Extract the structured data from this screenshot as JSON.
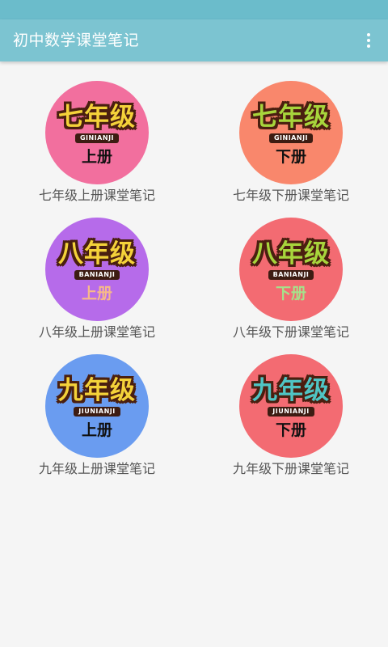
{
  "app": {
    "title": "初中数学课堂笔记",
    "menu_icon": "more-vertical-icon"
  },
  "items": [
    {
      "grade": "七年级",
      "pinyin": "GINIANJI",
      "volume": "上册",
      "label": "七年级上册课堂笔记",
      "bg": "#f26f9e",
      "grade_color": "#f4d23a",
      "vol_color": "#111111"
    },
    {
      "grade": "七年级",
      "pinyin": "GINIANJI",
      "volume": "下册",
      "label": "七年级下册课堂笔记",
      "bg": "#f9876c",
      "grade_color": "#a7d53c",
      "vol_color": "#111111"
    },
    {
      "grade": "八年级",
      "pinyin": "BANIANJI",
      "volume": "上册",
      "label": "八年级上册课堂笔记",
      "bg": "#b66bea",
      "grade_color": "#f4d23a",
      "vol_color": "#f7b98a"
    },
    {
      "grade": "八年级",
      "pinyin": "BANIANJI",
      "volume": "下册",
      "label": "八年级下册课堂笔记",
      "bg": "#f36b72",
      "grade_color": "#a7d53c",
      "vol_color": "#a7e08a"
    },
    {
      "grade": "九年级",
      "pinyin": "JIUNIANJI",
      "volume": "上册",
      "label": "九年级上册课堂笔记",
      "bg": "#6a9cf0",
      "grade_color": "#f4d23a",
      "vol_color": "#111111"
    },
    {
      "grade": "九年级",
      "pinyin": "JIUNIANJI",
      "volume": "下册",
      "label": "九年级下册课堂笔记",
      "bg": "#f36b72",
      "grade_color": "#4fc4c4",
      "vol_color": "#111111"
    }
  ]
}
